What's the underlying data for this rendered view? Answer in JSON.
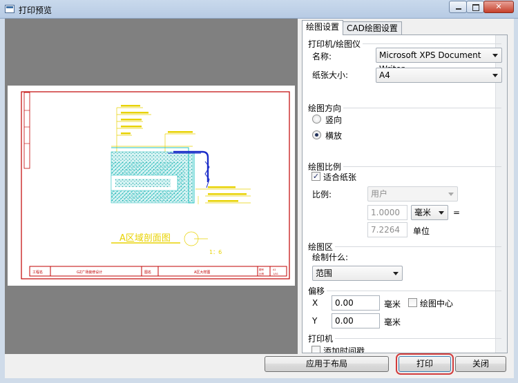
{
  "window": {
    "title": "打印预览",
    "close_glyph": "✕"
  },
  "tabs": [
    "绘图设置",
    "CAD绘图设置"
  ],
  "printer_plotter": {
    "title": "打印机/绘图仪",
    "name_label": "名称:",
    "name_value": "Microsoft XPS Document Writer",
    "paper_label": "纸张大小:",
    "paper_value": "A4"
  },
  "orientation": {
    "title": "绘图方向",
    "portrait": "竖向",
    "landscape": "横放",
    "selected": "landscape"
  },
  "scale": {
    "title": "绘图比例",
    "fit_label": "适合纸张",
    "fit_checked": true,
    "ratio_label": "比例:",
    "ratio_value": "用户",
    "value1": "1.0000",
    "unit1": "毫米",
    "equals": "=",
    "value2": "7.2264",
    "unit2": "单位"
  },
  "area": {
    "title": "绘图区",
    "what_label": "绘制什么:",
    "what_value": "范围"
  },
  "offset": {
    "title": "偏移",
    "x_label": "X",
    "x_value": "0.00",
    "x_unit": "毫米",
    "center_label": "绘图中心",
    "center_checked": false,
    "y_label": "Y",
    "y_value": "0.00",
    "y_unit": "毫米"
  },
  "printer": {
    "title": "打印机",
    "timestamp_label": "添加时间戳",
    "timestamp_checked": false
  },
  "buttons": {
    "apply": "应用于布局",
    "print": "打印",
    "close": "关闭"
  },
  "drawing": {
    "section_title": "A区域剖面图",
    "scale_text": "1：6",
    "title_block": [
      "工程名",
      "GZ广场装修设计",
      "图名",
      "A区大样图"
    ],
    "title_block_right": [
      "图号",
      "A1",
      "比例",
      "1/A1"
    ]
  },
  "colors": {
    "drawing_red": "#c00000",
    "drawing_yellow": "#e8d200",
    "drawing_cyan": "#22c0c0",
    "drawing_blue": "#1a2cc8",
    "highlight": "#d23c3c"
  }
}
